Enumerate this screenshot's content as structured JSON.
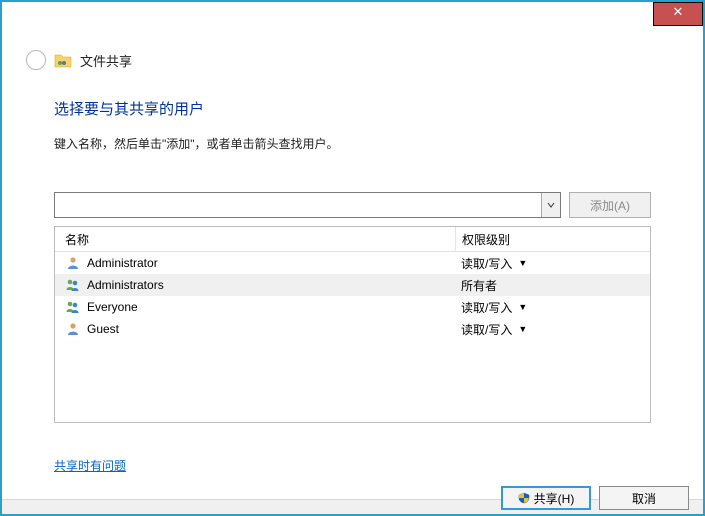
{
  "window": {
    "title": "文件共享"
  },
  "content": {
    "heading": "选择要与其共享的用户",
    "subtitle": "键入名称，然后单击\"添加\"，或者单击箭头查找用户。"
  },
  "combo": {
    "value": "",
    "placeholder": ""
  },
  "buttons": {
    "add": "添加(A)",
    "share": "共享(H)",
    "cancel": "取消"
  },
  "columns": {
    "name": "名称",
    "permission": "权限级别"
  },
  "rows": [
    {
      "icon": "user",
      "name": "Administrator",
      "permission": "读取/写入",
      "dropdown": true,
      "selected": false
    },
    {
      "icon": "group",
      "name": "Administrators",
      "permission": "所有者",
      "dropdown": false,
      "selected": true
    },
    {
      "icon": "group",
      "name": "Everyone",
      "permission": "读取/写入",
      "dropdown": true,
      "selected": false
    },
    {
      "icon": "user",
      "name": "Guest",
      "permission": "读取/写入",
      "dropdown": true,
      "selected": false
    }
  ],
  "help_link": "共享时有问题"
}
